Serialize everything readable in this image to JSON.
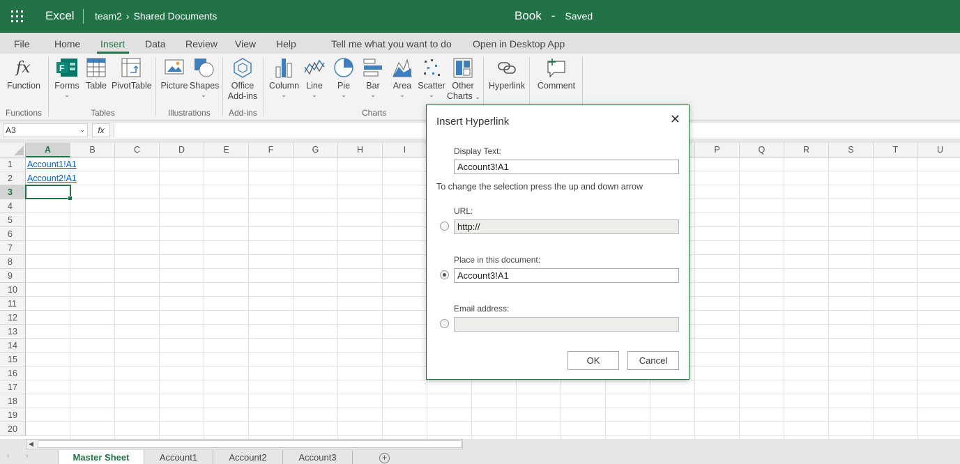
{
  "titlebar": {
    "app_name": "Excel",
    "breadcrumb_team": "team2",
    "breadcrumb_sep": "›",
    "breadcrumb_folder": "Shared Documents",
    "doc_name": "Book",
    "doc_dash": "-",
    "doc_status": "Saved"
  },
  "menu": [
    "File",
    "Home",
    "Insert",
    "Data",
    "Review",
    "View",
    "Help",
    "Tell me what you want to do",
    "Open in Desktop App"
  ],
  "menu_active": "Insert",
  "ribbon": {
    "function": "Function",
    "forms": "Forms",
    "table": "Table",
    "pivottable": "PivotTable",
    "picture": "Picture",
    "shapes": "Shapes",
    "office_addins_1": "Office",
    "office_addins_2": "Add-ins",
    "column": "Column",
    "line": "Line",
    "pie": "Pie",
    "bar": "Bar",
    "area": "Area",
    "scatter": "Scatter",
    "other_charts_1": "Other",
    "other_charts_2": "Charts",
    "hyperlink": "Hyperlink",
    "comment": "Comment",
    "groups": {
      "functions": "Functions",
      "tables": "Tables",
      "illustrations": "Illustrations",
      "addins": "Add-ins",
      "charts": "Charts"
    }
  },
  "formula_bar": {
    "name_box": "A3",
    "fx": "fx"
  },
  "grid": {
    "columns": [
      "A",
      "B",
      "C",
      "D",
      "E",
      "F",
      "G",
      "H",
      "I",
      "J",
      "K",
      "L",
      "M",
      "N",
      "O",
      "P",
      "Q",
      "R",
      "S",
      "T",
      "U"
    ],
    "rows": [
      "1",
      "2",
      "3",
      "4",
      "5",
      "6",
      "7",
      "8",
      "9",
      "10",
      "11",
      "12",
      "13",
      "14",
      "15",
      "16",
      "17",
      "18",
      "19",
      "20"
    ],
    "selected_column": "A",
    "selected_row": "3",
    "cells": {
      "A1": "Account1!A1",
      "A2": "Account2!A1"
    }
  },
  "sheets": [
    "Master Sheet",
    "Account1",
    "Account2",
    "Account3"
  ],
  "active_sheet": "Master Sheet",
  "dialog": {
    "title": "Insert Hyperlink",
    "close": "✕",
    "display_text_label": "Display Text:",
    "display_text_value": "Account3!A1",
    "hint": "To change the selection press the up and down arrow",
    "url_label": "URL:",
    "url_value": "http://",
    "place_label": "Place in this document:",
    "place_value": "Account3!A1",
    "email_label": "Email address:",
    "email_value": "",
    "selected_option": "place",
    "ok": "OK",
    "cancel": "Cancel"
  },
  "colors": {
    "brand": "#217346",
    "link": "#0563c1"
  }
}
